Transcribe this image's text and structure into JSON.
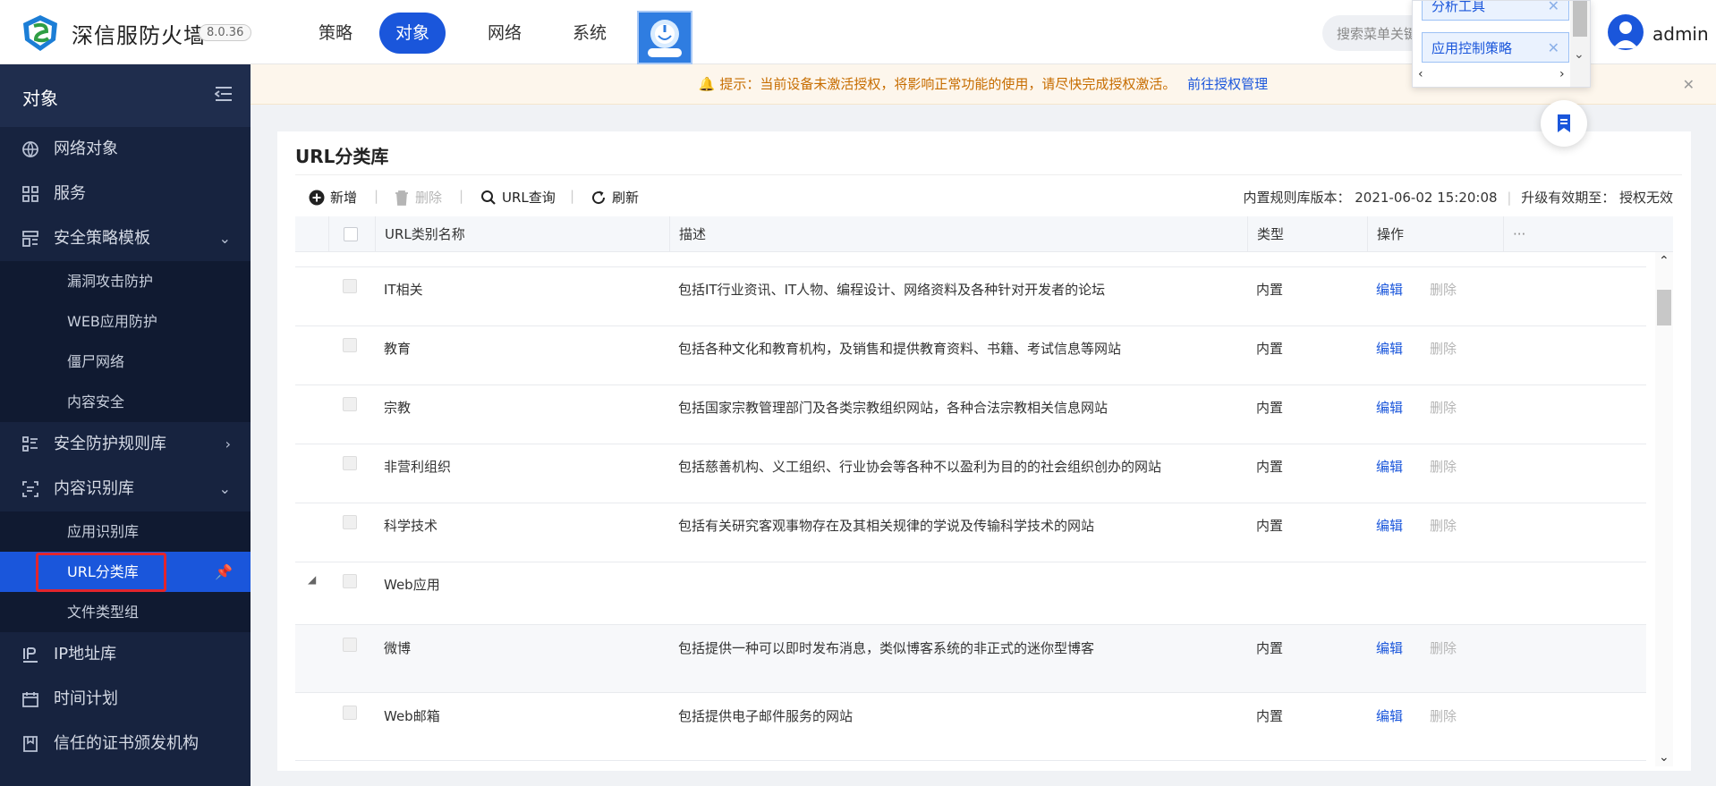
{
  "topbar": {
    "brand": "深信服防火墙",
    "version": "8.0.36",
    "nav": [
      "策略",
      "对象",
      "网络",
      "系统"
    ],
    "active_nav": 1,
    "search_placeholder": "搜索菜单关键",
    "username": "admin"
  },
  "quick_panel": {
    "tags": [
      "分析工具",
      "应用控制策略"
    ]
  },
  "sidebar": {
    "title": "对象",
    "items": [
      {
        "label": "网络对象",
        "icon": "globe-icon"
      },
      {
        "label": "服务",
        "icon": "grid-icon"
      },
      {
        "label": "安全策略模板",
        "icon": "template-icon",
        "expanded": true
      },
      {
        "label": "漏洞攻击防护"
      },
      {
        "label": "WEB应用防护"
      },
      {
        "label": "僵尸网络"
      },
      {
        "label": "内容安全"
      },
      {
        "label": "安全防护规则库",
        "icon": "list-icon",
        "expanded": false
      },
      {
        "label": "内容识别库",
        "icon": "scan-icon",
        "expanded": true
      },
      {
        "label": "应用识别库"
      },
      {
        "label": "URL分类库",
        "active": true
      },
      {
        "label": "文件类型组"
      },
      {
        "label": "IP地址库",
        "icon": "ip-icon"
      },
      {
        "label": "时间计划",
        "icon": "calendar-icon"
      },
      {
        "label": "信任的证书颁发机构",
        "icon": "cert-icon"
      }
    ]
  },
  "notice": {
    "text": "提示：当前设备未激活授权，将影响正常功能的使用，请尽快完成授权激活。",
    "link": "前往授权管理"
  },
  "page": {
    "title": "URL分类库",
    "toolbar": {
      "add": "新增",
      "delete": "删除",
      "query": "URL查询",
      "refresh": "刷新"
    },
    "version_label": "内置规则库版本：",
    "version_value": "2021-06-02 15:20:08",
    "expire_label": "升级有效期至：",
    "expire_value": "授权无效",
    "columns": [
      "URL类别名称",
      "描述",
      "类型",
      "操作"
    ],
    "column_more": "···",
    "edit_label": "编辑",
    "delete_label": "删除",
    "rows": [
      {
        "name": "IT相关",
        "desc": "包括IT行业资讯、IT人物、编程设计、网络资料及各种针对开发者的论坛",
        "type": "内置"
      },
      {
        "name": "教育",
        "desc": "包括各种文化和教育机构，及销售和提供教育资料、书籍、考试信息等网站",
        "type": "内置"
      },
      {
        "name": "宗教",
        "desc": "包括国家宗教管理部门及各类宗教组织网站，各种合法宗教相关信息网站",
        "type": "内置"
      },
      {
        "name": "非营利组织",
        "desc": "包括慈善机构、义工组织、行业协会等各种不以盈利为目的的社会组织创办的网站",
        "type": "内置"
      },
      {
        "name": "科学技术",
        "desc": "包括有关研究客观事物存在及其相关规律的学说及传输科学技术的网站",
        "type": "内置"
      },
      {
        "group": "Web应用"
      },
      {
        "name": "微博",
        "desc": "包括提供一种可以即时发布消息，类似博客系统的非正式的迷你型博客",
        "type": "内置"
      },
      {
        "name": "Web邮箱",
        "desc": "包括提供电子邮件服务的网站",
        "type": "内置"
      }
    ]
  }
}
